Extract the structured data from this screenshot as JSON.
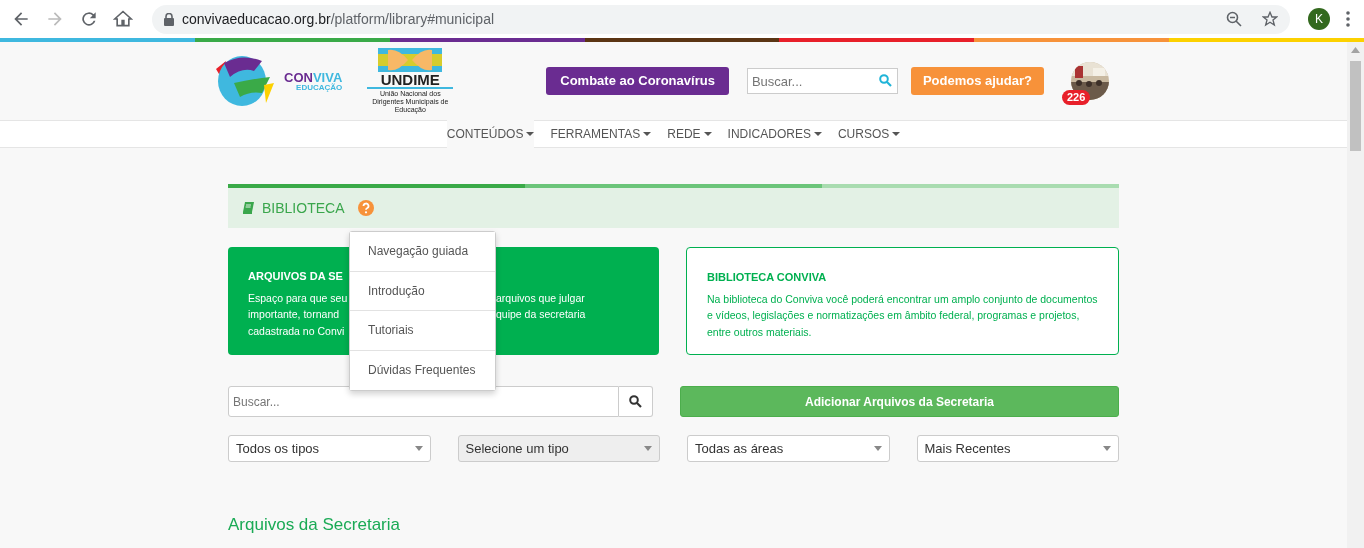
{
  "browser": {
    "nav_buttons": [
      {
        "kind": "back",
        "disabled": false
      },
      {
        "kind": "forward",
        "disabled": true
      },
      {
        "kind": "reload",
        "disabled": false
      },
      {
        "kind": "home",
        "disabled": false
      }
    ],
    "url_domain": "convivaeducacao.org.br",
    "url_path": "/platform/library#municipal",
    "profile_initial": "K"
  },
  "header": {
    "logo": {
      "con": "CON",
      "viva": "VIVA",
      "sub": "EDUCAÇÃO"
    },
    "partner_logo": {
      "name": "UNDIME",
      "caption": "União Nacional dos Dirigentes Municipais de Educação"
    },
    "campaign_button": "Combate ao Coronavírus",
    "search": {
      "placeholder": "Buscar..."
    },
    "help_button": "Podemos ajudar?",
    "notification_count": "226"
  },
  "nav": {
    "items": [
      {
        "label": "CONTEÚDOS",
        "selected": true
      },
      {
        "label": "FERRAMENTAS",
        "selected": false
      },
      {
        "label": "REDE",
        "selected": false
      },
      {
        "label": "INDICADORES",
        "selected": false
      },
      {
        "label": "CURSOS",
        "selected": false
      }
    ]
  },
  "library": {
    "title": "BIBLIOTECA",
    "help_menu": {
      "items": [
        "Navegação guiada",
        "Introdução",
        "Tutoriais",
        "Dúvidas Frequentes"
      ]
    },
    "cards": [
      {
        "kind": "filled",
        "title": "ARQUIVOS DA SE",
        "lines": [
          {
            "left": "Espaço para que seu",
            "right": "arquivos que julgar"
          },
          {
            "left": "importante, tornand",
            "right": "quipe da secretaria"
          },
          {
            "left": "cadastrada no Convi"
          }
        ]
      },
      {
        "kind": "outlined",
        "title": "BIBLIOTECA CONVIVA",
        "text": "Na biblioteca do Conviva você poderá encontrar um amplo conjunto de documentos e vídeos, legislações e normatizações em âmbito federal, programas e projetos, entre outros materiais."
      }
    ],
    "search": {
      "placeholder": "Buscar..."
    },
    "add_button": "Adicionar Arquivos da Secretaria",
    "filters": [
      {
        "value": "Todos os tipos",
        "disabled": false
      },
      {
        "value": "Selecione um tipo",
        "disabled": true
      },
      {
        "value": "Todas as áreas",
        "disabled": false
      },
      {
        "value": "Mais Recentes",
        "disabled": false
      }
    ],
    "section_title": "Arquivos da Secretaria"
  }
}
